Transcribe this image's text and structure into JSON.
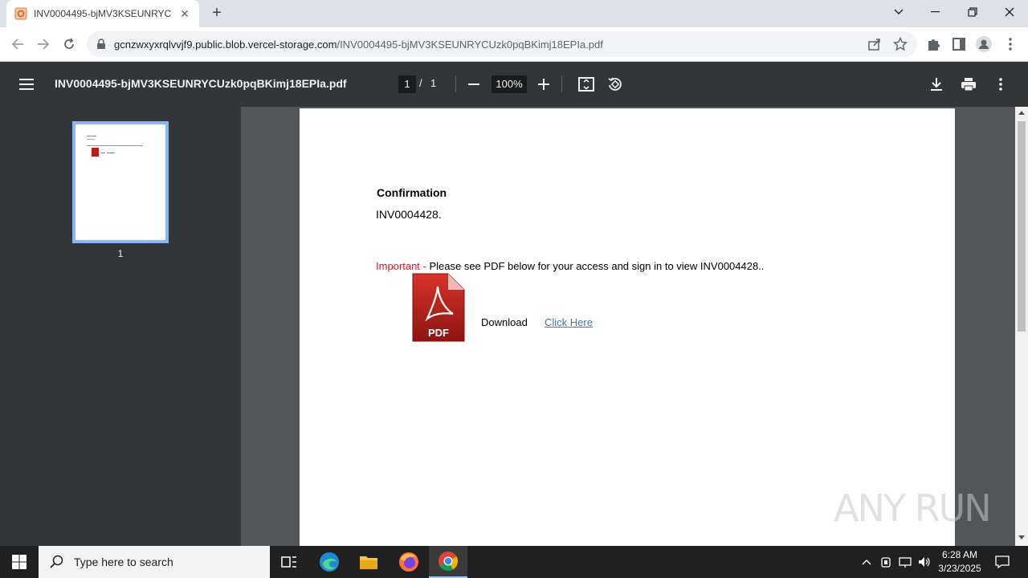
{
  "browser": {
    "tab_title": "INV0004495-bjMV3KSEUNRYCUzk0pqBKimj18EPIa.pdf",
    "url_host": "gcnzwxyxrqlvvjf9.public.blob.vercel-storage.com",
    "url_path": "/INV0004495-bjMV3KSEUNRYCUzk0pqBKimj18EPIa.pdf"
  },
  "pdf_viewer": {
    "file_name": "INV0004495-bjMV3KSEUNRYCUzk0pqBKimj18EPIa.pdf",
    "current_page": "1",
    "page_separator": "/",
    "total_pages": "1",
    "zoom": "100%",
    "thumbnail_label": "1"
  },
  "document": {
    "heading": "Confirmation",
    "invoice_line": "INV0004428.",
    "important_label": "Important -",
    "important_text": " Please see PDF below for your access and sign in to view INV0004428..",
    "pdf_icon_text": "PDF",
    "download_label": "Download",
    "link_text": "Click Here"
  },
  "watermark": "ANY RUN",
  "taskbar": {
    "search_placeholder": "Type here to search",
    "time": "6:28 AM",
    "date": "3/23/2025"
  },
  "colors": {
    "important_red": "#e0141e",
    "link_blue": "#3a79b8",
    "pdf_toolbar": "#323639",
    "viewer_bg": "#525659",
    "thumb_border": "#8ab4f8"
  }
}
